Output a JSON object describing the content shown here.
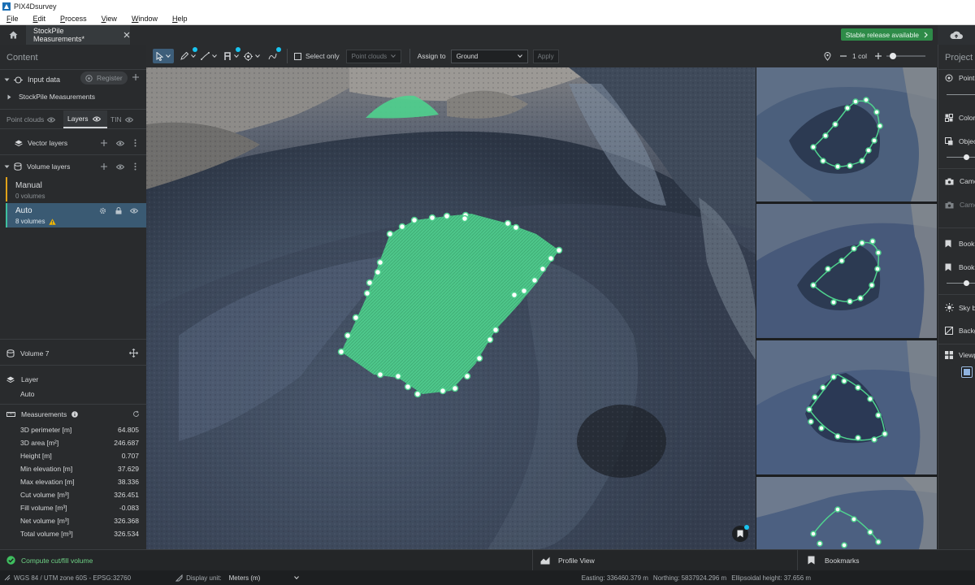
{
  "window": {
    "title": "PIX4Dsurvey"
  },
  "menu": [
    "File",
    "Edit",
    "Process",
    "View",
    "Window",
    "Help"
  ],
  "tab": {
    "label": "StockPile Measurements*"
  },
  "stable_release": "Stable release available",
  "left": {
    "content_title": "Content",
    "input_data": "Input data",
    "register": "Register",
    "project_item": "StockPile Measurements",
    "tabs": [
      "Point clouds",
      "Layers",
      "TIN"
    ],
    "vector_layers": "Vector layers",
    "volume_layers": "Volume layers",
    "manual": {
      "name": "Manual",
      "count": "0 volumes"
    },
    "auto": {
      "name": "Auto",
      "count": "8 volumes"
    },
    "volume_title": "Volume 7",
    "layer_label": "Layer",
    "layer_value": "Auto",
    "measurements_title": "Measurements",
    "measurements": [
      {
        "k": "3D perimeter [m]",
        "v": "64.805"
      },
      {
        "k": "3D area [m²]",
        "v": "246.687"
      },
      {
        "k": "Height [m]",
        "v": "0.707"
      },
      {
        "k": "Min elevation [m]",
        "v": "37.629"
      },
      {
        "k": "Max elevation [m]",
        "v": "38.336"
      },
      {
        "k": "Cut volume [m³]",
        "v": "326.451"
      },
      {
        "k": "Fill volume [m³]",
        "v": "-0.083"
      },
      {
        "k": "Net volume [m³]",
        "v": "326.368"
      },
      {
        "k": "Total volume [m³]",
        "v": "326.534"
      }
    ]
  },
  "toolbar": {
    "select_only": "Select only",
    "point_clouds": "Point clouds",
    "assign_to": "Assign to",
    "ground": "Ground",
    "apply": "Apply"
  },
  "right_header": {
    "cols": "1 col"
  },
  "right_panel": [
    "Point",
    "Color",
    "Object",
    "Came",
    "Came",
    "Book",
    "Book",
    "Sky b",
    "Backg",
    "Viewp"
  ],
  "project_title": "Project",
  "bottom": {
    "compute": "Compute cut/fill volume",
    "profile_view": "Profile View",
    "bookmarks": "Bookmarks"
  },
  "status": {
    "crs": "WGS 84 / UTM zone 60S - EPSG:32760",
    "display_unit_label": "Display unit:",
    "display_unit": "Meters (m)",
    "easting": "Easting: 336460.379 m",
    "northing": "Northing: 5837924.296 m",
    "ellipsoidal": "Ellipsoidal height: 37.656 m"
  },
  "colors": {
    "accent": "#3fbf7f",
    "selected_row": "#3a5a73",
    "stockpile": "#4fd18e",
    "warning": "#f0b400"
  }
}
